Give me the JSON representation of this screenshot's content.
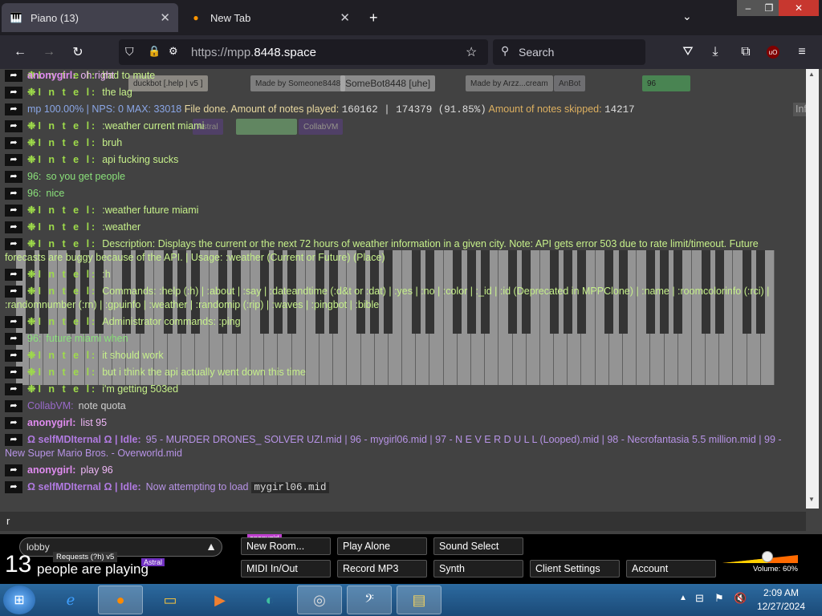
{
  "browser": {
    "tabs": [
      {
        "label": "Piano (13)",
        "active": true
      },
      {
        "label": "New Tab",
        "active": false
      }
    ],
    "url_scheme": "https://mpp.",
    "url_host": "8448.space",
    "search_placeholder": "Search"
  },
  "room_header": {
    "buttons": [
      "duckbot [.help | v5 ]",
      "Made by Someone8448",
      "SomeBot8448 [uhe]",
      "Made by Arzz...cream",
      "AnBot",
      "96",
      "Astral",
      "CollabVM"
    ],
    "stats_line_left": "mp 100.00% | NPS: 0 MAX: 33018",
    "stats_line_mid": "File done. Amount of notes played:",
    "notes_played": "160162",
    "notes_total": "174379",
    "notes_pct": "(91.85%)",
    "notes_skipped_label": "Amount of notes skipped:",
    "notes_skipped": "14217",
    "info_label": "Inf"
  },
  "chat": {
    "messages": [
      {
        "nick": "Intel",
        "type": "intel",
        "text": "had to mute"
      },
      {
        "nick": "Intel",
        "type": "intel",
        "text": "the lag"
      },
      {
        "nick": "",
        "type": "stats",
        "text": ""
      },
      {
        "nick": "Intel",
        "type": "intel",
        "text": ":weather current miami"
      },
      {
        "nick": "Intel",
        "type": "intel",
        "text": "bruh"
      },
      {
        "nick": "Intel",
        "type": "intel",
        "text": "api fucking sucks"
      },
      {
        "nick": "96:",
        "type": "96",
        "text": "so you get people"
      },
      {
        "nick": "96:",
        "type": "96",
        "text": "nice"
      },
      {
        "nick": "Intel",
        "type": "intel",
        "text": ":weather future miami"
      },
      {
        "nick": "Intel",
        "type": "intel",
        "text": ":weather"
      },
      {
        "nick": "Intel",
        "type": "intel",
        "text": "Description: Displays the current or the next 72 hours of weather information in a given city. Note: API gets error 503 due to rate limit/timeout. Future forecasts are buggy because of the API. | Usage: :weather (Current or Future) (Place)"
      },
      {
        "nick": "Intel",
        "type": "intel",
        "text": ":h"
      },
      {
        "nick": "Intel",
        "type": "intel",
        "text": "Commands: :help (:h) | :about | :say | :dateandtime (:d&t or :dat) | :yes | :no | :color | :_id | :id (Deprecated in MPPClone) | :name | :roomcolorinfo (:rci) | :randomnumber (:rn) | :gpuinfo | :weather | :randomip (:rip) | :waves | :pingbot | :bible"
      },
      {
        "nick": "Intel",
        "type": "intel",
        "text": "Administrator commands: :ping"
      },
      {
        "nick": "96:",
        "type": "96",
        "text": "future miami when"
      },
      {
        "nick": "Intel",
        "type": "intel",
        "text": "it should work"
      },
      {
        "nick": "Intel",
        "type": "intel",
        "text": "but i think the api actually went down this time"
      },
      {
        "nick": "Intel",
        "type": "intel",
        "text": "i'm getting 503ed"
      },
      {
        "nick": "CollabVM:",
        "type": "collab",
        "text": "note quota"
      },
      {
        "nick": "anonygirl:",
        "type": "anon",
        "text": "list 95"
      },
      {
        "nick": "Ω selfMDIternal Ω | Idle:",
        "type": "self",
        "text": "95 - MURDER DRONES_ SOLVER UZI.mid | 96 - mygirl06.mid | 97 - N E V E R D U L L (Looped).mid | 98 - Necrofantasia 5.5 million.mid | 99 - New Super Mario Bros. - Overworld.mid"
      },
      {
        "nick": "anonygirl:",
        "type": "anon",
        "text": "play 96"
      },
      {
        "nick": "Ω selfMDIternal Ω | Idle:",
        "type": "self",
        "text": "Now attempting to load",
        "mono": "mygirl06.mid"
      },
      {
        "nick": "anonygirl:",
        "type": "anon",
        "text": "oh right"
      }
    ],
    "input_value": "r"
  },
  "bottom_panel": {
    "room_name": "lobby",
    "room_badge": "Requests (?h) v5",
    "people_count": "13",
    "people_label": "people are playing",
    "cursor_tag_1": "anonygirl",
    "cursor_tag_2": "Astral",
    "buttons_row1": [
      "New Room...",
      "Play Alone",
      "Sound Select"
    ],
    "buttons_row2": [
      "MIDI In/Out",
      "Record MP3",
      "Synth",
      "Client Settings",
      "Account"
    ],
    "volume_label": "Volume: 60%",
    "volume_value": 0.6
  },
  "taskbar": {
    "time": "2:09 AM",
    "date": "12/27/2024"
  },
  "colors": {
    "intel_nick": "#9edb4a",
    "anon_nick": "#e08cf0",
    "self_nick": "#b07ae0"
  }
}
